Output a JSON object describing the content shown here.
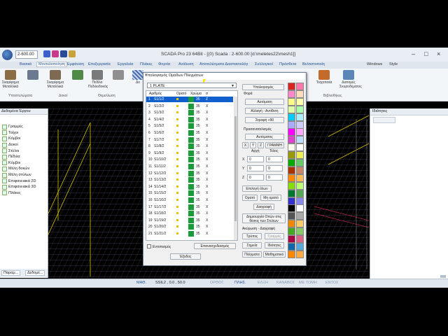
{
  "title": "SCADA Pro 23 64Bit - [(0) Scada : 2-600.00 [d:\\meletes22\\mesh1]]",
  "scale_value": "2-600.00",
  "window_controls": {
    "min": "–",
    "max": "□",
    "close": "×"
  },
  "menu": {
    "items": [
      "Βασικό",
      "Μοντελοποίηση",
      "Εμφάνιση",
      "Επεξεργασία",
      "Εργαλεία",
      "Πλάκες",
      "Φορτία",
      "Ανάλυση",
      "Αποτελέσματα Διαστασιολόγ",
      "Συλλογικοί",
      "Πρόσθετα",
      "Βελτιστοποίη"
    ],
    "right_items": [
      "Windows",
      "Style"
    ]
  },
  "ribbon": {
    "buttons": [
      "Σκαρίφημα Μεταλλικά",
      "Σκαρίφημα Μεταλλικά",
      "Πεδίλο Πεδιλοδοκός",
      "Δο",
      "Τοιχοποιία",
      "Διατομές Σκυροδέματος"
    ],
    "groups": [
      "Υποστυλώματα",
      "Δοκοί",
      "Θεμελίωση",
      "Βιβλιοθήκες"
    ]
  },
  "left_panel": {
    "header": "Δεδομένα Έργου",
    "tree": [
      "Γραμμές",
      "Τοίχοι",
      "Κόμβοι",
      "Δοκοί",
      "Στύλοι",
      "Πέδιλα",
      "Κόμβοι",
      "Μέλη δοκών",
      "Μέλη στύλων",
      "Επιφανειακά 2D",
      "Επιφανειακά 3D",
      "Πλάκες"
    ],
    "tabs": [
      "Παραμ...",
      "Δεδομέ..."
    ]
  },
  "right_panel": {
    "header": "Ιδιότητες"
  },
  "status_bar": {
    "left": "ΜΑΘ.",
    "coords": "SSIL2 , 0.0 , 50.0",
    "items": [
      "ΟΡΘΟΓ.",
      "ΠΛΗΣ.",
      "ΕΛΞΗ",
      "ΚΑΝΑΒΟΣ",
      "ΜΕ ΤΟΜΗ",
      "ΕΝΤΟΣ"
    ]
  },
  "dialog": {
    "title": "Υπολογισμός Ομάδων Πλεγμάτων",
    "close": "×",
    "combo_value": "1 PLATE",
    "columns": [
      "Αριθμός",
      "Ορατό",
      "Χρώμα",
      "σ"
    ],
    "rows": [
      {
        "n": "1",
        "name": "S1/1/2",
        "c": "35",
        "s": "Z"
      },
      {
        "n": "2",
        "name": "S1/2/2",
        "c": "35",
        "s": "X"
      },
      {
        "n": "3",
        "name": "S1/3/2",
        "c": "35",
        "s": "X"
      },
      {
        "n": "4",
        "name": "S1/4/2",
        "c": "35",
        "s": "X"
      },
      {
        "n": "5",
        "name": "S1/5/2",
        "c": "35",
        "s": "X"
      },
      {
        "n": "6",
        "name": "S1/6/2",
        "c": "35",
        "s": "X"
      },
      {
        "n": "7",
        "name": "S1/7/2",
        "c": "35",
        "s": "X"
      },
      {
        "n": "8",
        "name": "S1/8/2",
        "c": "35",
        "s": "X"
      },
      {
        "n": "9",
        "name": "S1/9/2",
        "c": "35",
        "s": "X"
      },
      {
        "n": "10",
        "name": "S1/10/2",
        "c": "35",
        "s": "X"
      },
      {
        "n": "11",
        "name": "S1/11/2",
        "c": "35",
        "s": "X"
      },
      {
        "n": "12",
        "name": "S1/12/2",
        "c": "35",
        "s": "X"
      },
      {
        "n": "13",
        "name": "S1/13/2",
        "c": "35",
        "s": "X"
      },
      {
        "n": "14",
        "name": "S1/14/2",
        "c": "35",
        "s": "X"
      },
      {
        "n": "15",
        "name": "S1/15/2",
        "c": "35",
        "s": "X"
      },
      {
        "n": "16",
        "name": "S1/16/2",
        "c": "35",
        "s": "X"
      },
      {
        "n": "17",
        "name": "S1/17/2",
        "c": "35",
        "s": "X"
      },
      {
        "n": "18",
        "name": "S1/18/2",
        "c": "35",
        "s": "X"
      },
      {
        "n": "19",
        "name": "S1/19/2",
        "c": "35",
        "s": "X"
      },
      {
        "n": "20",
        "name": "S1/20/2",
        "c": "35",
        "s": "X"
      },
      {
        "n": "21",
        "name": "S1/21/2",
        "c": "35",
        "s": "X"
      }
    ],
    "calc_button": "Υπολογισμός",
    "direction_label": "Φορά",
    "auto_button": "Αυτόματη",
    "reverse_button": "Αλλαγή - Αντίθετη",
    "rotate_button": "Στροφή +90",
    "orientation_label": "Προσανατολισμός",
    "orient_auto_button": "Αυτόματος",
    "axis_buttons": [
      "X",
      "Y",
      "Z",
      "ΓΡΑΜΜΗ"
    ],
    "start_label": "Αρχή",
    "end_label": "Τέλος",
    "coord_labels": [
      "X",
      "Y",
      "Z"
    ],
    "coord_values": [
      [
        "0",
        "0"
      ],
      [
        "0",
        "0"
      ],
      [
        "0",
        "0"
      ]
    ],
    "select_all_button": "Επιλογή όλων",
    "visible_button": "Ορατό",
    "not_visible_button": "Μη ορατό",
    "delete_button": "Διαγραφή",
    "create_openings_button": "Δημιουργία Οπών στις θέσεις των Στύλων",
    "nullify_label": "Ακύρωση - Διαγραφή",
    "modes": [
      "Τρύπες",
      "Γραμμές",
      "Σημεία",
      "Ιδιότητες",
      "Πλέγματα",
      "Μαθηματικό"
    ],
    "isolated_label": "Εντοπισμός",
    "recalc_button": "Επανασχεδιασμός",
    "exit_button": "Έξοδος",
    "selected_color": "#1a9c3a",
    "palette_colors": [
      "#d22",
      "#f7a",
      "#f8c",
      "#fdb",
      "#ff8",
      "#ffa",
      "#dfa",
      "#afa",
      "#0cf",
      "#aef",
      "#aaf",
      "#ccf",
      "#f0f",
      "#faf",
      "#d4c",
      "#bdf",
      "#ffe",
      "#fff",
      "#990",
      "#ee5",
      "#0a0",
      "#6c6",
      "#a30",
      "#c86",
      "#f80",
      "#fb5",
      "#8d0",
      "#bf7",
      "#073",
      "#5a5",
      "#33c",
      "#88e",
      "#000",
      "#fff",
      "#555",
      "#aaa",
      "#e80",
      "#fc6",
      "#4a2",
      "#8c6",
      "#a04",
      "#d68",
      "#16a",
      "#5ad",
      "#f80",
      "#fa4"
    ]
  }
}
